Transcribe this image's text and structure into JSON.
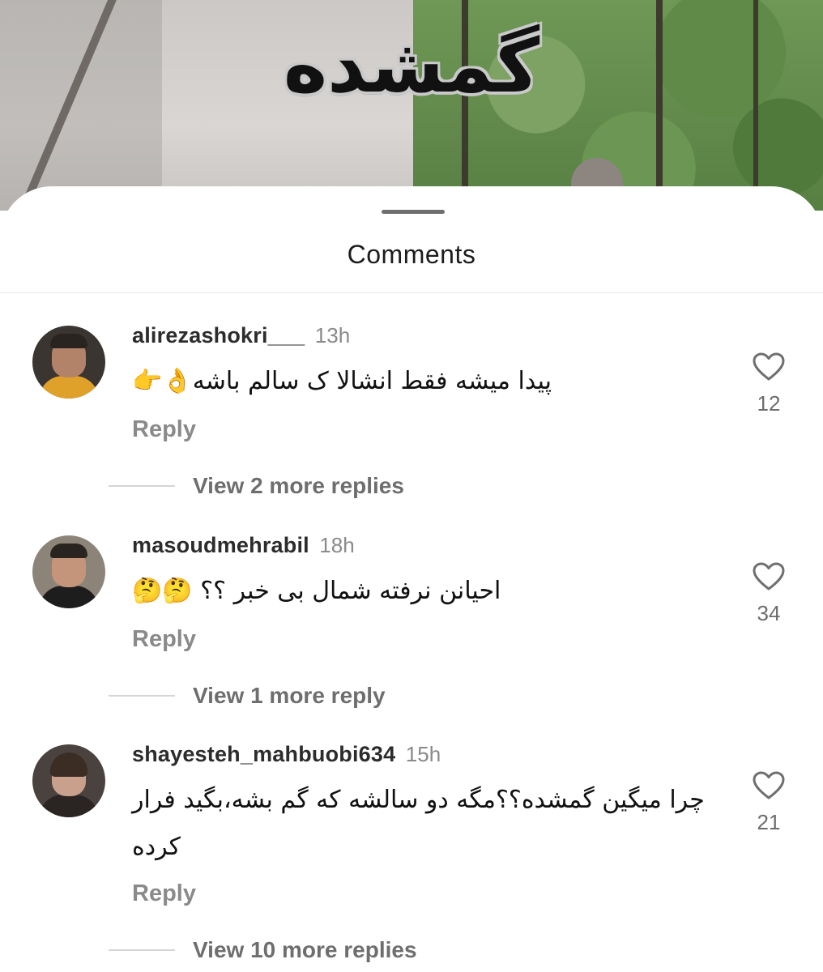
{
  "video": {
    "title": "گمشده"
  },
  "sheet": {
    "title": "Comments"
  },
  "comments": [
    {
      "username": "alirezashokri___",
      "time": "13h",
      "text": "پیدا میشه فقط انشالا ک سالم باشه👌👉",
      "reply_label": "Reply",
      "likes": "12",
      "more_replies": "View 2 more replies"
    },
    {
      "username": "masoudmehrabil",
      "time": "18h",
      "text": "احیانن نرفته شمال بی خبر ؟؟ 🤔🤔",
      "reply_label": "Reply",
      "likes": "34",
      "more_replies": "View 1 more reply"
    },
    {
      "username": "shayesteh_mahbuobi634",
      "time": "15h",
      "text": "چرا میگین گمشده؟؟مگه دو سالشه که گم بشه،بگید فرار کرده",
      "reply_label": "Reply",
      "likes": "21",
      "more_replies": "View 10 more replies"
    }
  ],
  "colors": {
    "heart_stroke": "#6f6f6f",
    "text": "#111111",
    "muted": "#8a8a8a"
  }
}
